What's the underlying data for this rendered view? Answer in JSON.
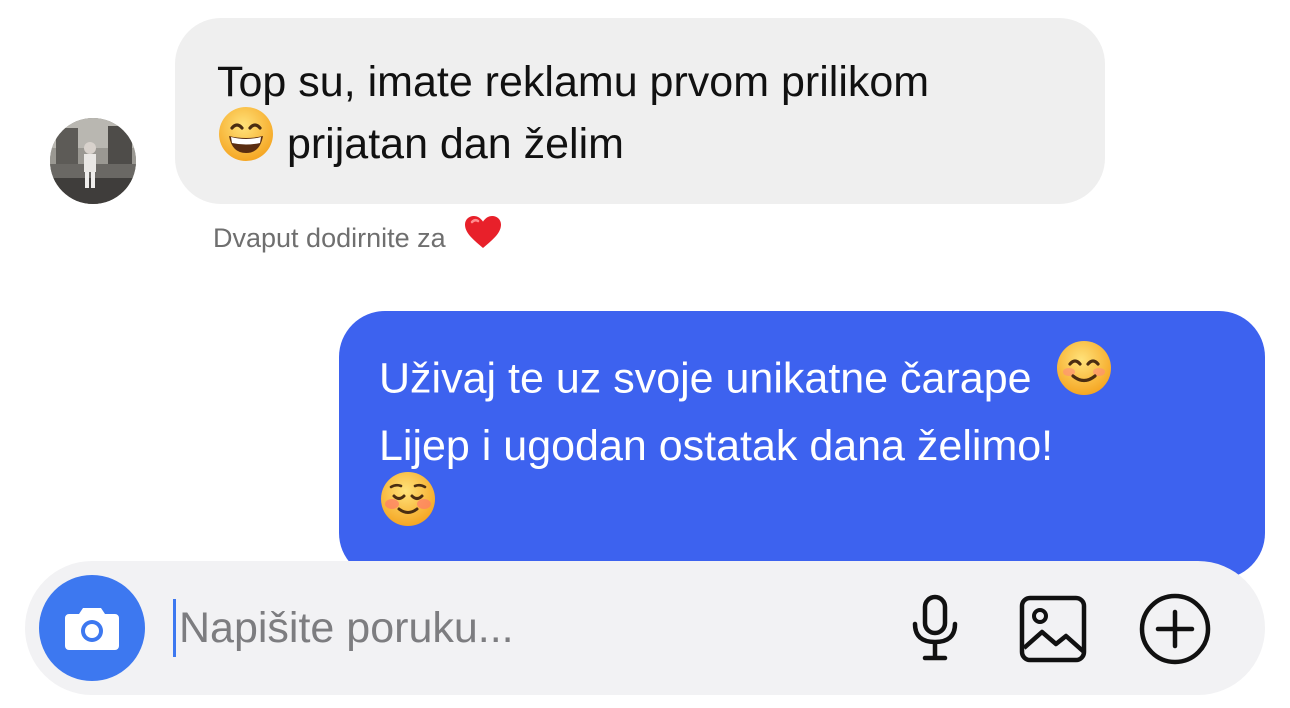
{
  "conversation": {
    "incoming_message": {
      "line1": "Top su, imate reklamu prvom prilikom",
      "line2": "prijatan dan želim",
      "emoji": "grinning-face-with-smiling-eyes"
    },
    "reaction_hint": {
      "text": "Dvaput dodirnite za",
      "icon": "heart-icon"
    },
    "outgoing_message": {
      "line1": "Uživaj te uz svoje unikatne čarape",
      "line2": "Lijep i ugodan ostatak dana želimo!",
      "emoji_line1": "smiling-face-with-smiling-eyes",
      "emoji_line3": "smiling-face"
    }
  },
  "composer": {
    "placeholder": "Napišite poruku...",
    "value": "",
    "buttons": {
      "camera": "camera-icon",
      "microphone": "microphone-icon",
      "gallery": "gallery-icon",
      "plus": "plus-icon"
    }
  },
  "colors": {
    "incoming_bubble": "#efefef",
    "outgoing_bubble": "#3d62ef",
    "camera_button": "#3d78f0",
    "composer_background": "#f2f2f4",
    "heart": "#e8202a"
  }
}
